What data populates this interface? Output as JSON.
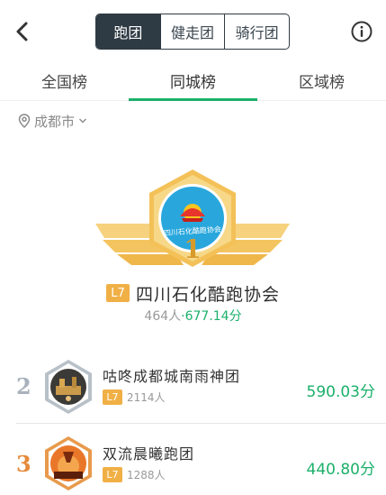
{
  "nav": {
    "segments": [
      {
        "label": "跑团",
        "active": true
      },
      {
        "label": "健走团",
        "active": false
      },
      {
        "label": "骑行团",
        "active": false
      }
    ]
  },
  "tabs": [
    {
      "label": "全国榜",
      "active": false
    },
    {
      "label": "同城榜",
      "active": true
    },
    {
      "label": "区域榜",
      "active": false
    }
  ],
  "city": {
    "label": "成都市"
  },
  "first": {
    "rank": "1",
    "banner_text": "四川石化酷跑协会",
    "level": "L7",
    "name": "四川石化酷跑协会",
    "members": "464人",
    "separator": "·",
    "distance": "677.14分"
  },
  "rows": [
    {
      "rank": "2",
      "name": "咕咚成都城南雨神团",
      "level": "L7",
      "members": "2114人",
      "distance": "590.03分"
    },
    {
      "rank": "3",
      "name": "双流晨曦跑团",
      "level": "L7",
      "members": "1288人",
      "distance": "440.80分"
    }
  ],
  "colors": {
    "accent_green": "#1bb06a",
    "dark": "#2f3b44",
    "gold": "#f0b046",
    "silver": "#a9b2bc",
    "bronze": "#e58a3a"
  },
  "icons": {
    "back": "chevron-left-icon",
    "info": "info-circle-icon",
    "location": "location-pin-icon",
    "city_dropdown": "chevron-down-icon"
  }
}
